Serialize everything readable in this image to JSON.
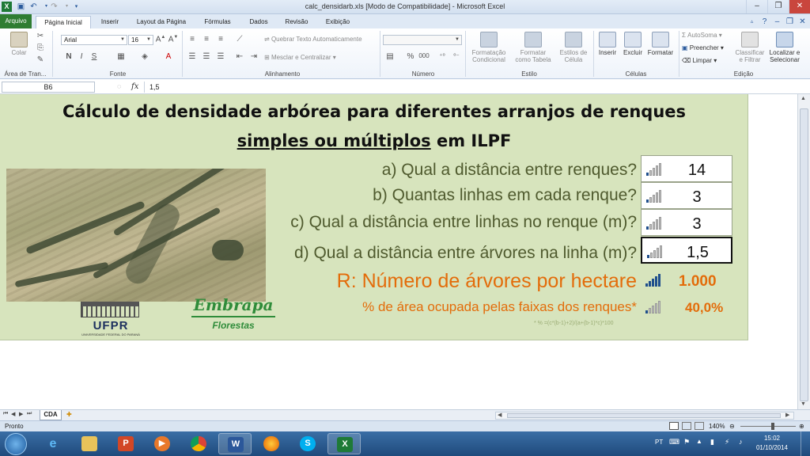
{
  "window": {
    "title": "calc_densidarb.xls  [Modo de Compatibilidade] - Microsoft Excel",
    "controls": [
      "–",
      "❐",
      "✕"
    ]
  },
  "ribbon_tabs": [
    {
      "label": "Arquivo"
    },
    {
      "label": "Página Inicial"
    },
    {
      "label": "Inserir"
    },
    {
      "label": "Layout da Página"
    },
    {
      "label": "Fórmulas"
    },
    {
      "label": "Dados"
    },
    {
      "label": "Revisão"
    },
    {
      "label": "Exibição"
    }
  ],
  "ribbon": {
    "clipboard": {
      "paste": "Colar",
      "label": "Área de Tran..."
    },
    "font": {
      "name": "Arial",
      "size": "16",
      "label": "Fonte",
      "bold": "N",
      "italic": "I",
      "underline": "S"
    },
    "alignment": {
      "wrap": "Quebrar Texto Automaticamente",
      "merge": "Mesclar e Centralizar",
      "label": "Alinhamento"
    },
    "number": {
      "format": "",
      "percent": "%",
      "thousands": "000",
      "label": "Número"
    },
    "styles": {
      "conditional": [
        "Formatação",
        "Condicional"
      ],
      "table": [
        "Formatar",
        "como Tabela"
      ],
      "cell": [
        "Estilos de",
        "Célula"
      ],
      "label": "Estilo"
    },
    "cells": {
      "insert": "Inserir",
      "delete": "Excluir",
      "format": "Formatar",
      "label": "Células"
    },
    "editing": {
      "autosum": "AutoSoma",
      "fill": "Preencher",
      "clear": "Limpar",
      "sort": [
        "Classificar",
        "e Filtrar"
      ],
      "find": [
        "Localizar e",
        "Selecionar"
      ],
      "label": "Edição"
    }
  },
  "formula_bar": {
    "name_box": "B6",
    "fx": "fx",
    "value": "1,5"
  },
  "sheet": {
    "title_line1": "Cálculo de densidade arbórea para diferentes arranjos de renques",
    "title_line2_underlined": "simples ou múltiplos",
    "title_line2_rest": " em ILPF",
    "questions": [
      {
        "text": "a) Qual a distância entre renques?",
        "value": "14"
      },
      {
        "text": "b) Quantas linhas em cada renque?",
        "value": "3"
      },
      {
        "text": "c) Qual a distância entre linhas no renque (m)?",
        "value": "3"
      },
      {
        "text": "d) Qual a distância entre árvores na linha (m)?",
        "value": "1,5"
      }
    ],
    "result_label": "R: Número de árvores por hectare",
    "result_value": "1.000",
    "area_label": "% de área ocupada pelas faixas dos renques*",
    "area_value": "40,0%",
    "footnote": "* % =(c*(b-1)+2)/(a+(b-1)*c)*100",
    "logo_ufpr": "UFPR",
    "logo_ufpr_sub": "UNIVERSIDADE FEDERAL DO PARANÁ",
    "logo_embrapa": "Embrapa",
    "logo_embrapa_sub": "Florestas"
  },
  "sheet_tabs": [
    {
      "label": "CDA"
    }
  ],
  "status_bar": {
    "ready": "Pronto",
    "zoom": "140%"
  },
  "taskbar": {
    "lang": "PT",
    "time": "15:02",
    "date": "01/10/2014"
  },
  "colors": {
    "panel": "#d7e4bd",
    "question_text": "#4f5a2e",
    "result": "#e36c0a",
    "file_tab": "#2f7d32"
  }
}
